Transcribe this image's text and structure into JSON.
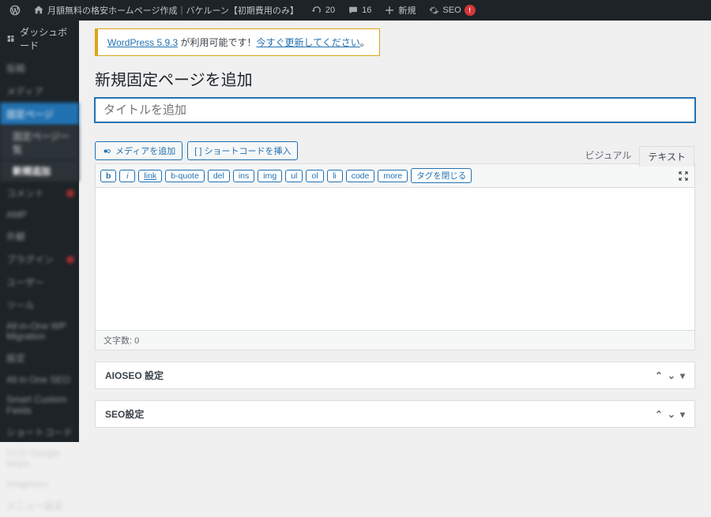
{
  "adminbar": {
    "site_title": "月額無料の格安ホームページ作成｜バケルーン【初期費用のみ】",
    "updates_count": "20",
    "comments_count": "16",
    "new_label": "新規",
    "seo_label": "SEO"
  },
  "sidebar": {
    "dashboard": "ダッシュボード",
    "items": [
      "投稿",
      "メディア",
      "固定ページ",
      "固定ページ一覧",
      "新規追加",
      "コメント",
      "AMP",
      "外観",
      "プラグイン",
      "ユーザー",
      "ツール",
      "All-in-One WP Migration",
      "設定",
      "All in One SEO",
      "Smart Custom Fields",
      "ショートコード",
      "YCG Google Maps",
      "Imagenes",
      "メニュー設定"
    ]
  },
  "notice": {
    "prefix": "WordPress 5.9.3",
    "middle": " が利用可能です！",
    "link": "今すぐ更新してください",
    "suffix": "。"
  },
  "page": {
    "heading": "新規固定ページを追加",
    "title_placeholder": "タイトルを追加"
  },
  "media_buttons": {
    "add_media": "メディアを追加",
    "shortcode": "[ ] ショートコードを挿入"
  },
  "editor": {
    "tabs": {
      "visual": "ビジュアル",
      "text": "テキスト"
    },
    "quicktags": [
      "b",
      "i",
      "link",
      "b-quote",
      "del",
      "ins",
      "img",
      "ul",
      "ol",
      "li",
      "code",
      "more",
      "タグを閉じる"
    ],
    "word_count_label": "文字数:",
    "word_count_value": "0"
  },
  "panels": [
    {
      "title": "AIOSEO 設定"
    },
    {
      "title": "SEO設定"
    }
  ]
}
